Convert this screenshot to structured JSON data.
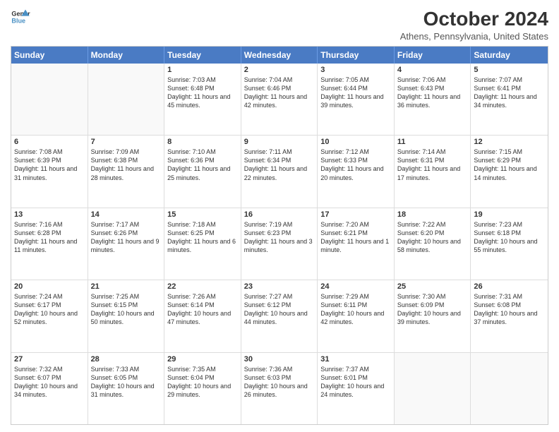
{
  "logo": {
    "line1": "General",
    "line2": "Blue"
  },
  "title": "October 2024",
  "subtitle": "Athens, Pennsylvania, United States",
  "days": [
    "Sunday",
    "Monday",
    "Tuesday",
    "Wednesday",
    "Thursday",
    "Friday",
    "Saturday"
  ],
  "weeks": [
    [
      {
        "num": "",
        "info": ""
      },
      {
        "num": "",
        "info": ""
      },
      {
        "num": "1",
        "info": "Sunrise: 7:03 AM\nSunset: 6:48 PM\nDaylight: 11 hours and 45 minutes."
      },
      {
        "num": "2",
        "info": "Sunrise: 7:04 AM\nSunset: 6:46 PM\nDaylight: 11 hours and 42 minutes."
      },
      {
        "num": "3",
        "info": "Sunrise: 7:05 AM\nSunset: 6:44 PM\nDaylight: 11 hours and 39 minutes."
      },
      {
        "num": "4",
        "info": "Sunrise: 7:06 AM\nSunset: 6:43 PM\nDaylight: 11 hours and 36 minutes."
      },
      {
        "num": "5",
        "info": "Sunrise: 7:07 AM\nSunset: 6:41 PM\nDaylight: 11 hours and 34 minutes."
      }
    ],
    [
      {
        "num": "6",
        "info": "Sunrise: 7:08 AM\nSunset: 6:39 PM\nDaylight: 11 hours and 31 minutes."
      },
      {
        "num": "7",
        "info": "Sunrise: 7:09 AM\nSunset: 6:38 PM\nDaylight: 11 hours and 28 minutes."
      },
      {
        "num": "8",
        "info": "Sunrise: 7:10 AM\nSunset: 6:36 PM\nDaylight: 11 hours and 25 minutes."
      },
      {
        "num": "9",
        "info": "Sunrise: 7:11 AM\nSunset: 6:34 PM\nDaylight: 11 hours and 22 minutes."
      },
      {
        "num": "10",
        "info": "Sunrise: 7:12 AM\nSunset: 6:33 PM\nDaylight: 11 hours and 20 minutes."
      },
      {
        "num": "11",
        "info": "Sunrise: 7:14 AM\nSunset: 6:31 PM\nDaylight: 11 hours and 17 minutes."
      },
      {
        "num": "12",
        "info": "Sunrise: 7:15 AM\nSunset: 6:29 PM\nDaylight: 11 hours and 14 minutes."
      }
    ],
    [
      {
        "num": "13",
        "info": "Sunrise: 7:16 AM\nSunset: 6:28 PM\nDaylight: 11 hours and 11 minutes."
      },
      {
        "num": "14",
        "info": "Sunrise: 7:17 AM\nSunset: 6:26 PM\nDaylight: 11 hours and 9 minutes."
      },
      {
        "num": "15",
        "info": "Sunrise: 7:18 AM\nSunset: 6:25 PM\nDaylight: 11 hours and 6 minutes."
      },
      {
        "num": "16",
        "info": "Sunrise: 7:19 AM\nSunset: 6:23 PM\nDaylight: 11 hours and 3 minutes."
      },
      {
        "num": "17",
        "info": "Sunrise: 7:20 AM\nSunset: 6:21 PM\nDaylight: 11 hours and 1 minute."
      },
      {
        "num": "18",
        "info": "Sunrise: 7:22 AM\nSunset: 6:20 PM\nDaylight: 10 hours and 58 minutes."
      },
      {
        "num": "19",
        "info": "Sunrise: 7:23 AM\nSunset: 6:18 PM\nDaylight: 10 hours and 55 minutes."
      }
    ],
    [
      {
        "num": "20",
        "info": "Sunrise: 7:24 AM\nSunset: 6:17 PM\nDaylight: 10 hours and 52 minutes."
      },
      {
        "num": "21",
        "info": "Sunrise: 7:25 AM\nSunset: 6:15 PM\nDaylight: 10 hours and 50 minutes."
      },
      {
        "num": "22",
        "info": "Sunrise: 7:26 AM\nSunset: 6:14 PM\nDaylight: 10 hours and 47 minutes."
      },
      {
        "num": "23",
        "info": "Sunrise: 7:27 AM\nSunset: 6:12 PM\nDaylight: 10 hours and 44 minutes."
      },
      {
        "num": "24",
        "info": "Sunrise: 7:29 AM\nSunset: 6:11 PM\nDaylight: 10 hours and 42 minutes."
      },
      {
        "num": "25",
        "info": "Sunrise: 7:30 AM\nSunset: 6:09 PM\nDaylight: 10 hours and 39 minutes."
      },
      {
        "num": "26",
        "info": "Sunrise: 7:31 AM\nSunset: 6:08 PM\nDaylight: 10 hours and 37 minutes."
      }
    ],
    [
      {
        "num": "27",
        "info": "Sunrise: 7:32 AM\nSunset: 6:07 PM\nDaylight: 10 hours and 34 minutes."
      },
      {
        "num": "28",
        "info": "Sunrise: 7:33 AM\nSunset: 6:05 PM\nDaylight: 10 hours and 31 minutes."
      },
      {
        "num": "29",
        "info": "Sunrise: 7:35 AM\nSunset: 6:04 PM\nDaylight: 10 hours and 29 minutes."
      },
      {
        "num": "30",
        "info": "Sunrise: 7:36 AM\nSunset: 6:03 PM\nDaylight: 10 hours and 26 minutes."
      },
      {
        "num": "31",
        "info": "Sunrise: 7:37 AM\nSunset: 6:01 PM\nDaylight: 10 hours and 24 minutes."
      },
      {
        "num": "",
        "info": ""
      },
      {
        "num": "",
        "info": ""
      }
    ]
  ]
}
